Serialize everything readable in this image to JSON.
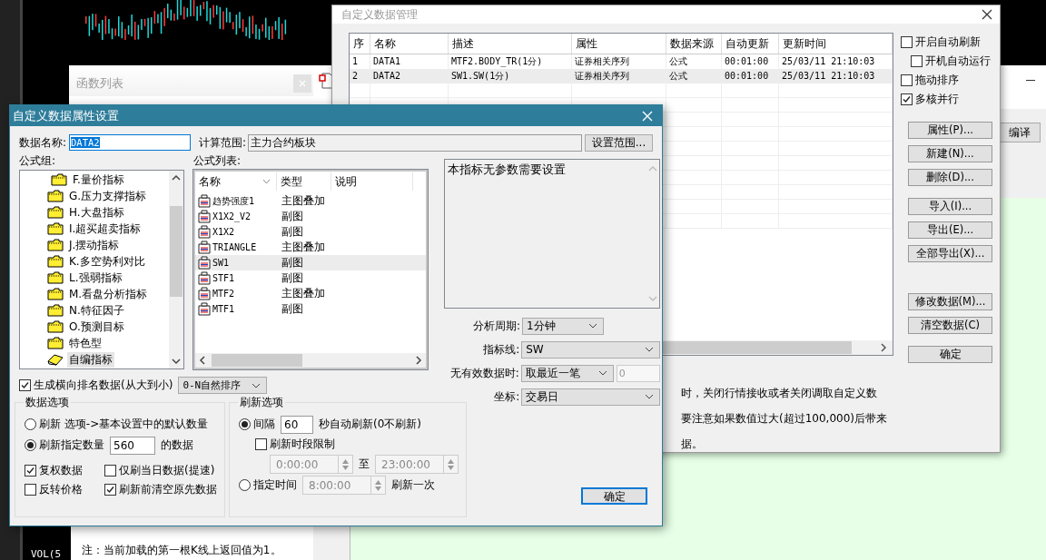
{
  "background": {
    "chart_label": "VOL(5",
    "function_list": {
      "title": "函数列表",
      "note": "注：当前加载的第一根K线上返回值为1。"
    },
    "editor": {
      "compile_button": "编译"
    }
  },
  "manager": {
    "title": "自定义数据管理",
    "columns": [
      "序",
      "名称",
      "描述",
      "属性",
      "数据来源",
      "自动更新",
      "更新时间"
    ],
    "rows": [
      {
        "cells": [
          "1",
          "DATA1",
          "MTF2.BODY_TR(1分)",
          "证券相关序列",
          "公式",
          "00:01:00",
          "25/03/11 21:10:03"
        ],
        "selected": false
      },
      {
        "cells": [
          "2",
          "DATA2",
          "SW1.SW(1分)",
          "证券相关序列",
          "公式",
          "00:01:00",
          "25/03/11 21:10:03"
        ],
        "selected": true
      }
    ],
    "options": [
      {
        "label": "开启自动刷新",
        "checked": false,
        "children": [
          {
            "label": "开机自动运行",
            "checked": false
          }
        ]
      },
      {
        "label": "拖动排序",
        "checked": false
      },
      {
        "label": "多核并行",
        "checked": true
      }
    ],
    "button_groups": [
      [
        "属性(P)...",
        "新建(N)...",
        "删除(D)..."
      ],
      [
        "导入(I)...",
        "导出(E)...",
        "全部导出(X)..."
      ],
      [
        "修改数据(M)...",
        "清空数据(C)"
      ],
      [
        "确定"
      ]
    ],
    "notes": [
      "时，关闭行情接收或者关闭调取自定义数",
      "要注意如果数值过大(超过100,000)后带来",
      "据。"
    ]
  },
  "dialog": {
    "title": "自定义数据属性设置",
    "name_label": "数据名称:",
    "name_value": "DATA2",
    "range_label": "计算范围:",
    "range_value": "主力合约板块",
    "range_button": "设置范围...",
    "group_label": "公式组:",
    "list_label": "公式列表:",
    "tree": [
      {
        "label": "F.量价指标",
        "kind": "folder",
        "selected": false
      },
      {
        "label": "G.压力支撑指标",
        "kind": "folder",
        "selected": false
      },
      {
        "label": "H.大盘指标",
        "kind": "folder",
        "selected": false
      },
      {
        "label": "I.超买超卖指标",
        "kind": "folder",
        "selected": false
      },
      {
        "label": "J.摆动指标",
        "kind": "folder",
        "selected": false
      },
      {
        "label": "K.多空势利对比",
        "kind": "folder",
        "selected": false
      },
      {
        "label": "L.强弱指标",
        "kind": "folder",
        "selected": false
      },
      {
        "label": "M.看盘分析指标",
        "kind": "folder",
        "selected": false
      },
      {
        "label": "N.特征因子",
        "kind": "folder",
        "selected": false
      },
      {
        "label": "O.预测目标",
        "kind": "folder",
        "selected": false
      },
      {
        "label": "特色型",
        "kind": "folder",
        "selected": false
      },
      {
        "label": "自编指标",
        "kind": "book",
        "selected": true
      }
    ],
    "list_columns": [
      "名称",
      "类型",
      "说明"
    ],
    "formulas": [
      {
        "name": "趋势强度1",
        "type": "主图叠加",
        "selected": false
      },
      {
        "name": "X1X2_V2",
        "type": "副图",
        "selected": false
      },
      {
        "name": "X1X2",
        "type": "副图",
        "selected": false
      },
      {
        "name": "TRIANGLE",
        "type": "主图叠加",
        "selected": false
      },
      {
        "name": "SW1",
        "type": "副图",
        "selected": true
      },
      {
        "name": "STF1",
        "type": "副图",
        "selected": false
      },
      {
        "name": "MTF2",
        "type": "主图叠加",
        "selected": false
      },
      {
        "name": "MTF1",
        "type": "副图",
        "selected": false
      }
    ],
    "description": "本指标无参数需要设置",
    "params": [
      {
        "label": "分析周期:",
        "value": "1分钟",
        "kind": "short_select"
      },
      {
        "label": "指标线:",
        "value": "SW",
        "kind": "select"
      },
      {
        "label": "无有效数据时:",
        "value": "取最近一笔",
        "kind": "select_with_field",
        "field": "0"
      },
      {
        "label": "坐标:",
        "value": "交易日",
        "kind": "select"
      }
    ],
    "rank": {
      "label": "生成横向排名数据(从大到小)",
      "checked": true,
      "sort": "0-N自然排序"
    },
    "data_options": {
      "title": "数据选项",
      "radios": [
        {
          "label": "刷新 选项->基本设置中的默认数量",
          "selected": false
        },
        {
          "label": "刷新指定数量",
          "selected": true,
          "value": "560",
          "suffix": "的数据"
        }
      ],
      "checkboxes": [
        {
          "label": "复权数据",
          "checked": true
        },
        {
          "label": "仅刷当日数据(提速)",
          "checked": false
        },
        {
          "label": "反转价格",
          "checked": false
        },
        {
          "label": "刷新前清空原先数据",
          "checked": true
        }
      ]
    },
    "refresh_options": {
      "title": "刷新选项",
      "interval": {
        "label": "间隔",
        "selected": true,
        "value": "60",
        "suffix": "秒自动刷新(0不刷新)"
      },
      "limit": {
        "label": "刷新时段限制",
        "checked": false,
        "from": "0:00:00",
        "separator": "至",
        "to": "23:00:00"
      },
      "fixed": {
        "label": "指定时间",
        "selected": false,
        "time": "8:00:00",
        "suffix": "刷新一次"
      }
    },
    "ok_button": "确定"
  }
}
